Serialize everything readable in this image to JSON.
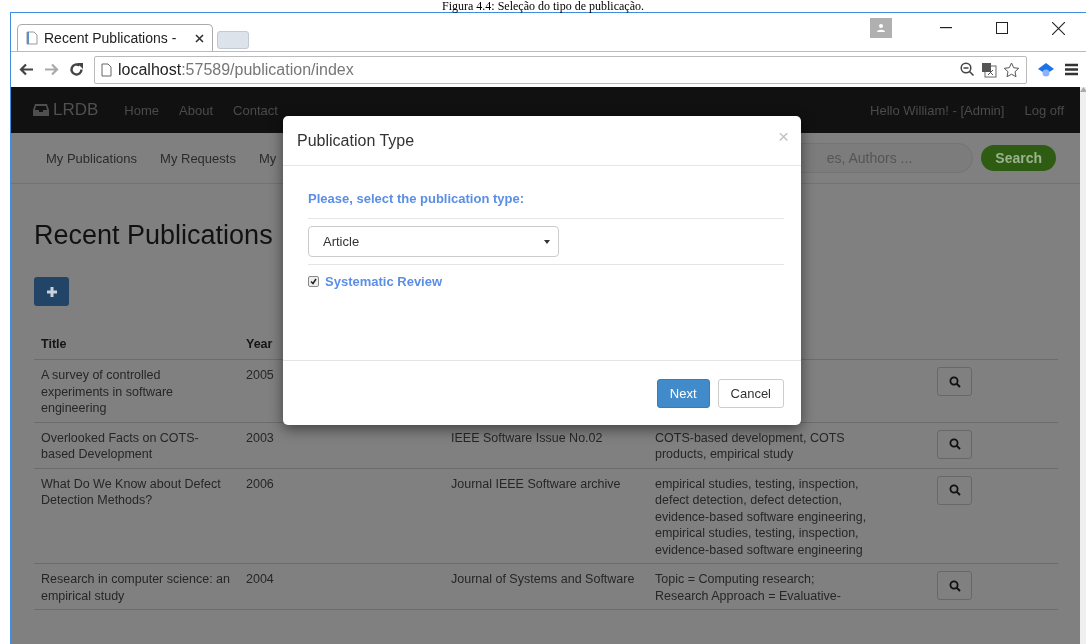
{
  "caption": "Figura 4.4: Seleção do tipo de publicação.",
  "browser": {
    "tabs": [
      {
        "title": "Recent Publications -",
        "selected": true
      }
    ],
    "address": {
      "host": "localhost",
      "path": ":57589/publication/index"
    }
  },
  "navbar": {
    "brand": "LRDB",
    "links": [
      "Home",
      "About",
      "Contact"
    ],
    "user": "Hello William! - [Admin]",
    "logoff": "Log off"
  },
  "subnav": {
    "links": [
      "My Publications",
      "My Requests",
      "My"
    ],
    "search_value": "es, Authors ...",
    "search_button": "Search"
  },
  "page_title": "Recent Publications",
  "table": {
    "columns": [
      "Title",
      "Year"
    ],
    "rows": [
      {
        "title": "A survey of controlled experiments in software engineering",
        "year": "2005"
      },
      {
        "title": "Overlooked Facts on COTS-based Development",
        "year": "2003",
        "journal": "IEEE Software Issue No.02",
        "keywords": "COTS-based development, COTS products, empirical study"
      },
      {
        "title": "What Do We Know about Defect Detection Methods?",
        "year": "2006",
        "journal": "Journal IEEE Software archive",
        "keywords": "empirical studies, testing, inspection, defect detection, defect detection, evidence-based software engineering, empirical studies, testing, inspection, evidence-based software engineering"
      },
      {
        "title": "Research in computer science: an empirical study",
        "year": "2004",
        "journal": "Journal of Systems and Software",
        "keywords": "Topic = Computing research; Research Approach = Evaluative-"
      }
    ]
  },
  "modal": {
    "title": "Publication Type",
    "close": "×",
    "prompt": "Please, select the publication type:",
    "select_value": "Article",
    "checkbox": {
      "label": "Systematic Review",
      "checked": true
    },
    "buttons": [
      {
        "label": "Next",
        "kind": "primary"
      },
      {
        "label": "Cancel",
        "kind": "default"
      }
    ]
  }
}
